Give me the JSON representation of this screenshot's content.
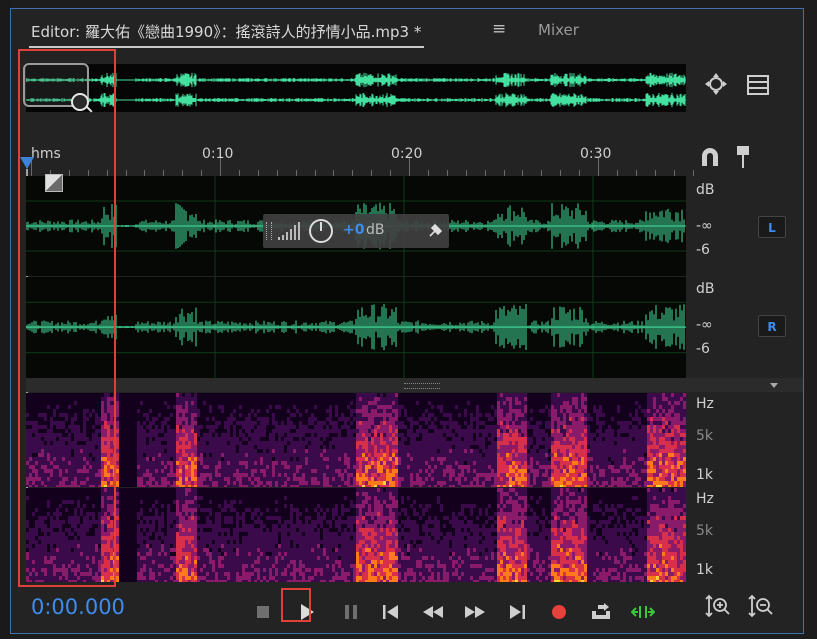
{
  "tabs": {
    "editor_label": "Editor: 羅大佑《戀曲1990》：搖滾詩人的抒情小品.mp3 *",
    "menu_icon": "≡",
    "mixer_label": "Mixer"
  },
  "ruler": {
    "unit_label": "hms",
    "marks": [
      "0:10",
      "0:20",
      "0:30"
    ]
  },
  "channels": [
    {
      "db_top": "dB",
      "db_mid": "-∞",
      "db_bottom": "-6",
      "button": "L"
    },
    {
      "db_top": "dB",
      "db_mid": "-∞",
      "db_bottom": "-6",
      "button": "R"
    }
  ],
  "hud": {
    "gain_value": "+0",
    "gain_unit": "dB"
  },
  "spectral_scale": [
    {
      "top": "Hz",
      "mid": "5k",
      "bottom": "1k"
    },
    {
      "top": "Hz",
      "mid": "5k",
      "bottom": "1k"
    }
  ],
  "transport": {
    "timecode": "0:00.000"
  },
  "colors": {
    "waveform": "#44e0a0",
    "accent_blue": "#3e8cf0",
    "highlight_red": "#e0403a",
    "record_red": "#e8403a",
    "loop_green": "#3ec43e"
  }
}
